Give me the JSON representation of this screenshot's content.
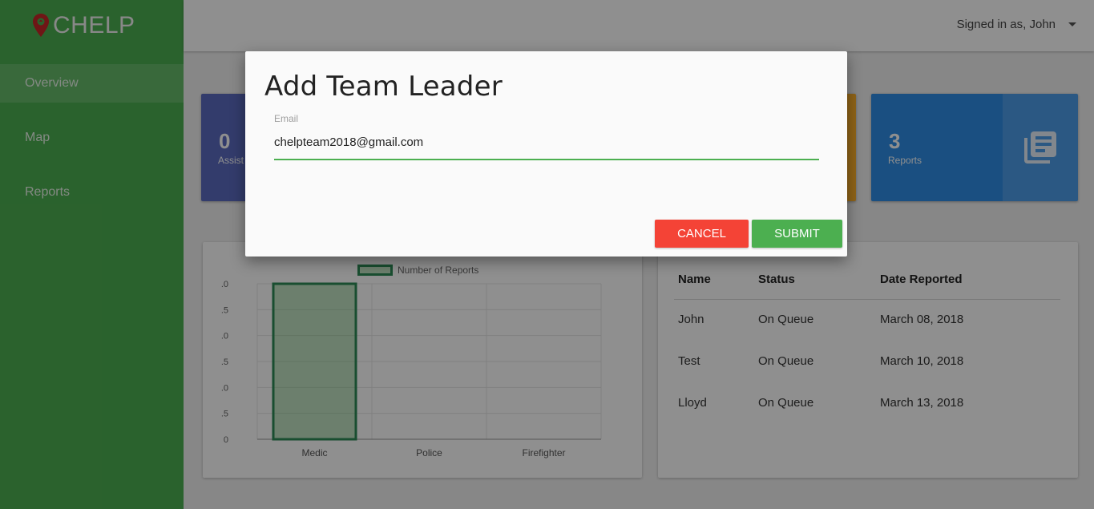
{
  "brand": {
    "name": "CHELP"
  },
  "sidebar": {
    "items": [
      {
        "label": "Overview"
      },
      {
        "label": "Map"
      },
      {
        "label": "Reports"
      }
    ]
  },
  "header": {
    "user_label": "Signed in as, John"
  },
  "stats": [
    {
      "value": "0",
      "label": "Assist",
      "color": "#5c6bc0"
    },
    {
      "value": "",
      "label": "",
      "color": "#ffb22b"
    },
    {
      "value": "3",
      "label": "Reports",
      "color": "#2f8ee6",
      "icon": "reports-icon"
    }
  ],
  "chart_data": {
    "type": "bar",
    "categories": [
      "Medic",
      "Police",
      "Firefighter"
    ],
    "series": [
      {
        "name": "Number of Reports",
        "values": [
          3,
          0,
          0
        ]
      }
    ],
    "y_ticks": [
      ".0",
      ".5",
      ".0",
      ".5",
      ".0",
      ".5",
      "0"
    ],
    "ylim": [
      0,
      3
    ],
    "grid": true,
    "legend": "top",
    "bar_color": "#2e8b57"
  },
  "table": {
    "headers": [
      "Name",
      "Status",
      "Date Reported"
    ],
    "rows": [
      [
        "John",
        "On Queue",
        "March 08, 2018"
      ],
      [
        "Test",
        "On Queue",
        "March 10, 2018"
      ],
      [
        "Lloyd",
        "On Queue",
        "March 13, 2018"
      ]
    ]
  },
  "modal": {
    "title": "Add Team Leader",
    "email_label": "Email",
    "email_value": "chelpteam2018@gmail.com",
    "cancel_label": "CANCEL",
    "submit_label": "SUBMIT"
  },
  "colors": {
    "primary": "#4caf50",
    "danger": "#f44336"
  }
}
